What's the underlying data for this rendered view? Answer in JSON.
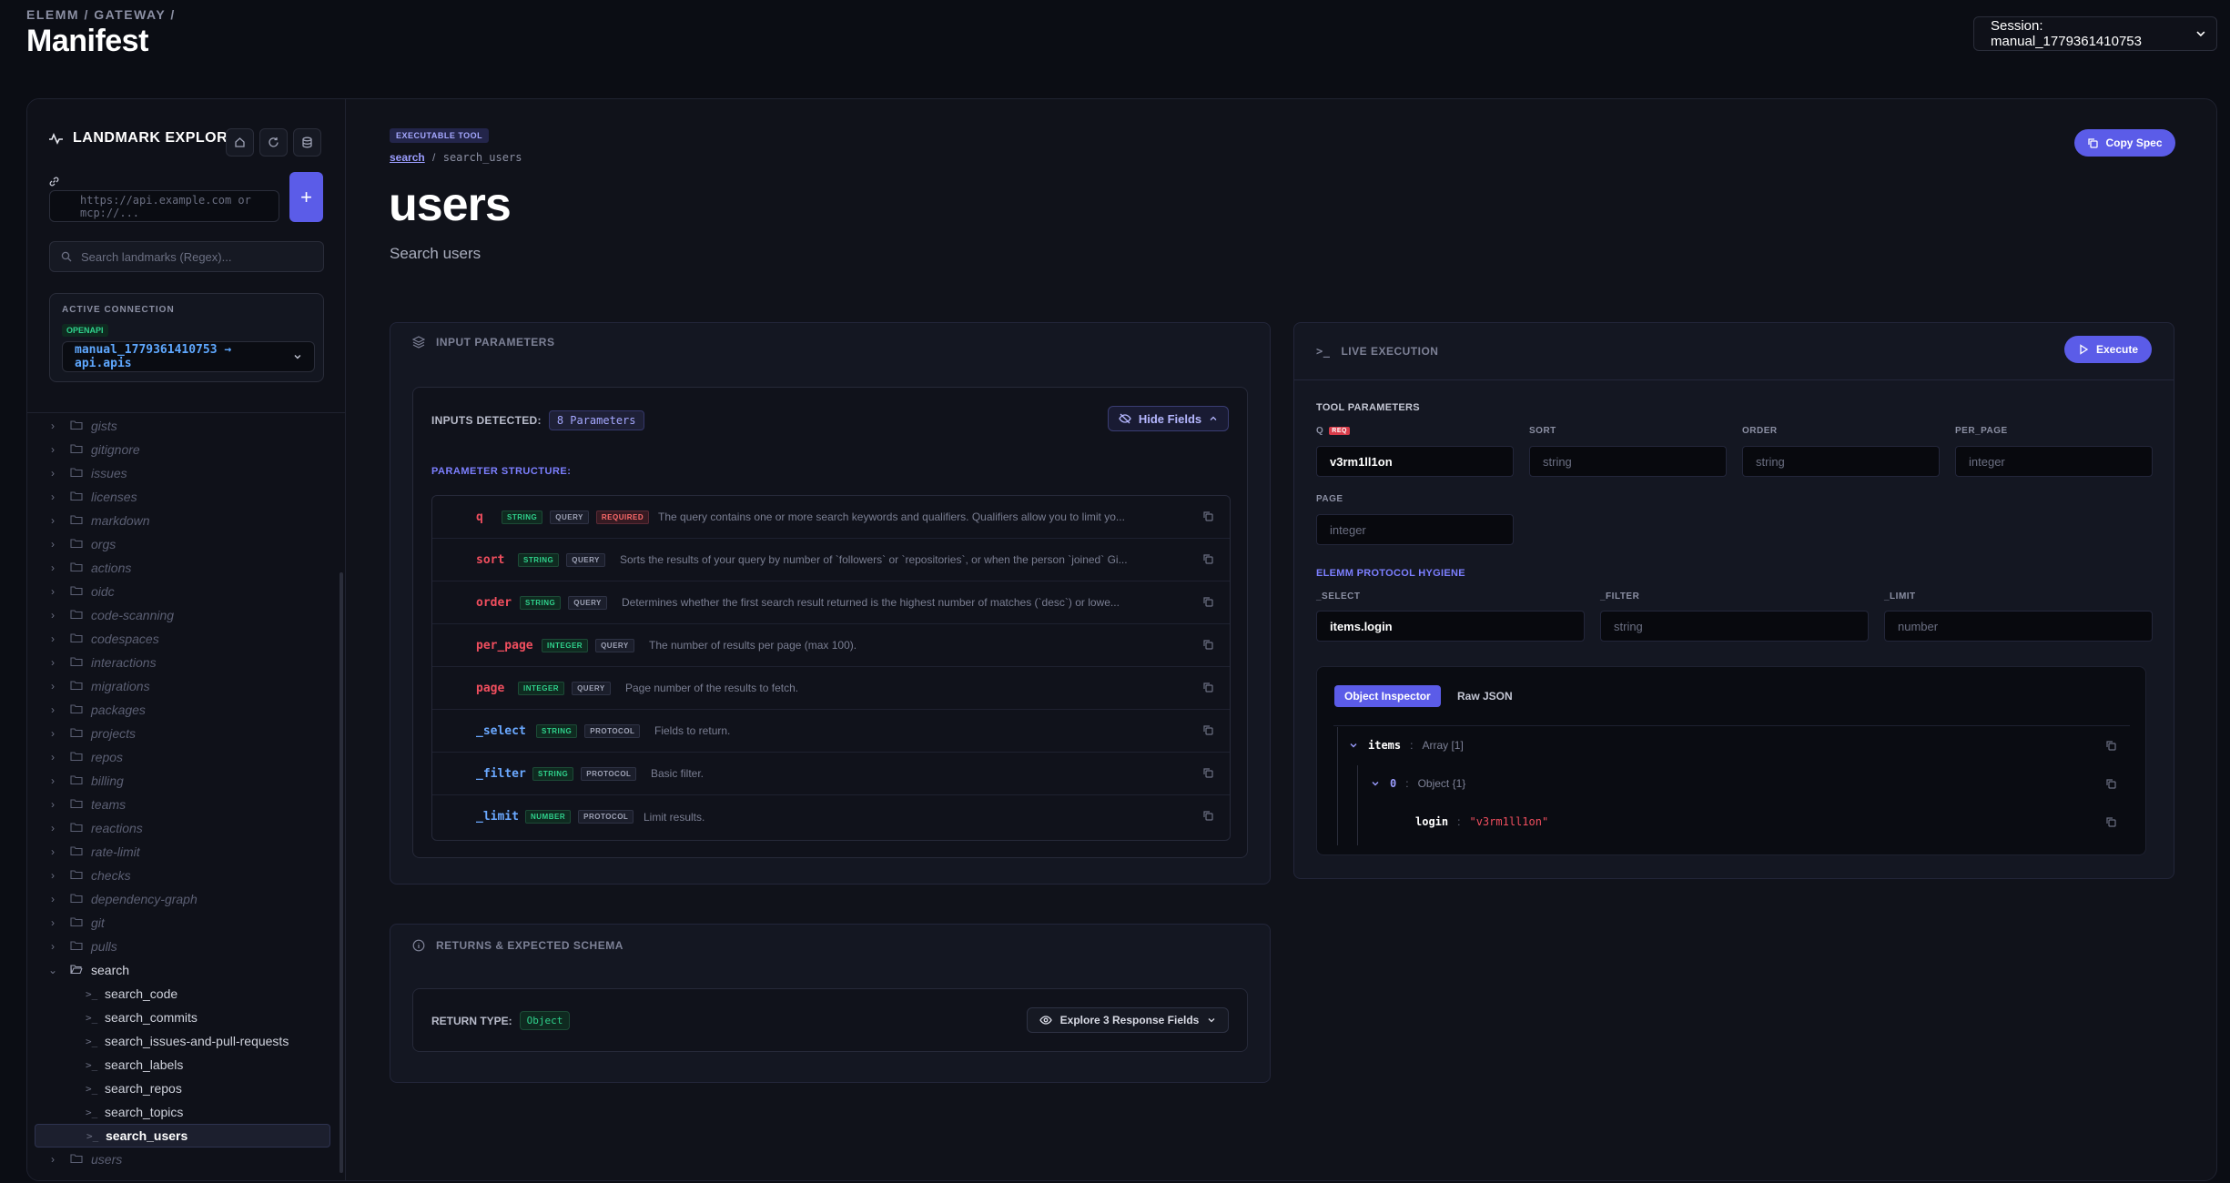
{
  "header": {
    "breadcrumb": "ELEMM / GATEWAY /",
    "title": "Manifest",
    "session": "Session: manual_1779361410753"
  },
  "sidebar": {
    "title": "LANDMARK EXPLORER",
    "url_placeholder": "https://api.example.com or mcp://...",
    "search_placeholder": "Search landmarks (Regex)...",
    "add_label": "+",
    "connection": {
      "label": "ACTIVE CONNECTION",
      "type": "OPENAPI",
      "name": "manual_1779361410753 → api.apis"
    },
    "tree": [
      "gists",
      "gitignore",
      "issues",
      "licenses",
      "markdown",
      "orgs",
      "actions",
      "oidc",
      "code-scanning",
      "codespaces",
      "interactions",
      "migrations",
      "packages",
      "projects",
      "repos",
      "billing",
      "teams",
      "reactions",
      "rate-limit",
      "checks",
      "dependency-graph",
      "git",
      "pulls"
    ],
    "open_folder": "search",
    "children": [
      "search_code",
      "search_commits",
      "search_issues-and-pull-requests",
      "search_labels",
      "search_repos",
      "search_topics",
      "search_users"
    ],
    "after": [
      "users"
    ]
  },
  "tool": {
    "badge": "EXECUTABLE TOOL",
    "crumb_link": "search",
    "crumb_sep": "/",
    "crumb_current": "search_users",
    "title": "users",
    "description": "Search users",
    "copy_label": "Copy Spec"
  },
  "inputs": {
    "header": "INPUT PARAMETERS",
    "detected_label": "INPUTS DETECTED:",
    "detected_count": "8 Parameters",
    "hide_label": "Hide Fields",
    "structure_label": "PARAMETER STRUCTURE:",
    "params": [
      {
        "name": "q",
        "type": "STRING",
        "loc": "QUERY",
        "req": "REQUIRED",
        "desc": "The query contains one or more search keywords and qualifiers. Qualifiers allow you to limit yo..."
      },
      {
        "name": "sort",
        "type": "STRING",
        "loc": "QUERY",
        "req": "",
        "desc": "Sorts the results of your query by number of `followers` or `repositories`, or when the person `joined` Gi..."
      },
      {
        "name": "order",
        "type": "STRING",
        "loc": "QUERY",
        "req": "",
        "desc": "Determines whether the first search result returned is the highest number of matches (`desc`) or lowe..."
      },
      {
        "name": "per_page",
        "type": "INTEGER",
        "loc": "QUERY",
        "req": "",
        "desc": "The number of results per page (max 100)."
      },
      {
        "name": "page",
        "type": "INTEGER",
        "loc": "QUERY",
        "req": "",
        "desc": "Page number of the results to fetch."
      },
      {
        "name": "_select",
        "type": "STRING",
        "loc": "PROTOCOL",
        "req": "",
        "desc": "Fields to return."
      },
      {
        "name": "_filter",
        "type": "STRING",
        "loc": "PROTOCOL",
        "req": "",
        "desc": "Basic filter."
      },
      {
        "name": "_limit",
        "type": "NUMBER",
        "loc": "PROTOCOL",
        "req": "",
        "desc": "Limit results."
      }
    ]
  },
  "execution": {
    "header": "LIVE EXECUTION",
    "execute_label": "Execute",
    "tool_params_label": "TOOL PARAMETERS",
    "req_badge": "REQ",
    "fields": {
      "q": {
        "label": "Q",
        "value": "v3rm1ll1on"
      },
      "sort": {
        "label": "SORT",
        "placeholder": "string"
      },
      "order": {
        "label": "ORDER",
        "placeholder": "string"
      },
      "per_page": {
        "label": "PER_PAGE",
        "placeholder": "integer"
      },
      "page": {
        "label": "PAGE",
        "placeholder": "integer"
      }
    },
    "hygiene_label": "ELEMM PROTOCOL HYGIENE",
    "hygiene": {
      "select": {
        "label": "_SELECT",
        "value": "items.login"
      },
      "filter": {
        "label": "_FILTER",
        "placeholder": "string"
      },
      "limit": {
        "label": "_LIMIT",
        "placeholder": "number"
      }
    },
    "tabs": {
      "inspector": "Object Inspector",
      "raw": "Raw JSON"
    },
    "json": {
      "items_key": "items",
      "items_type": "Array [1]",
      "idx_key": "0",
      "idx_type": "Object {1}",
      "login_key": "login",
      "login_val": "\"v3rm1ll1on\"",
      "colon": ":"
    }
  },
  "returns": {
    "header": "RETURNS & EXPECTED SCHEMA",
    "type_label": "RETURN TYPE:",
    "type": "Object",
    "explore_label": "Explore 3 Response Fields"
  }
}
